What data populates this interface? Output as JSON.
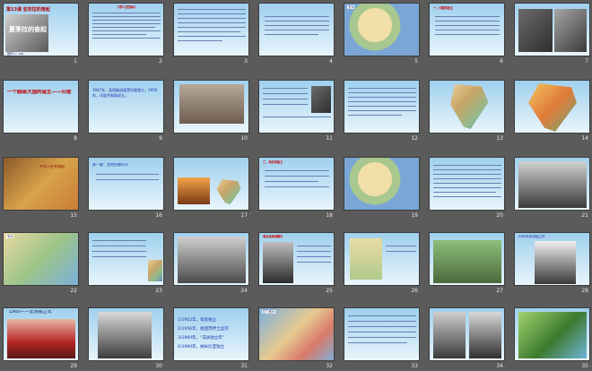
{
  "slides": [
    {
      "n": "1",
      "title": "第13课 亚非拉的奋起",
      "sub": "夏季拉的奋起",
      "author": "制作人：xxx"
    },
    {
      "n": "2",
      "heading": "【学习目标】"
    },
    {
      "n": "3"
    },
    {
      "n": "4"
    },
    {
      "n": "5",
      "label": "亚洲"
    },
    {
      "n": "6",
      "heading": "一、印度的独立"
    },
    {
      "n": "7"
    },
    {
      "n": "8",
      "text": "一个超级大国的诞生——印度"
    },
    {
      "n": "9",
      "text": "1947年，英国被迫接受印度独立。1950年，印度共和国成立。"
    },
    {
      "n": "10"
    },
    {
      "n": "11"
    },
    {
      "n": "12"
    },
    {
      "n": "13"
    },
    {
      "n": "14"
    },
    {
      "n": "15",
      "label": "中华人民共和国"
    },
    {
      "n": "16",
      "text": "第一题：甘地在做什么"
    },
    {
      "n": "17"
    },
    {
      "n": "18",
      "heading": "二、埃及的独立"
    },
    {
      "n": "19"
    },
    {
      "n": "20"
    },
    {
      "n": "21"
    },
    {
      "n": "22",
      "label": "非洲"
    },
    {
      "n": "23"
    },
    {
      "n": "24"
    },
    {
      "n": "25",
      "heading": "埃及总统纳赛尔"
    },
    {
      "n": "26"
    },
    {
      "n": "27"
    },
    {
      "n": "28",
      "heading": "1960年非洲独立年"
    },
    {
      "n": "29",
      "heading": "1960——非洲独立年"
    },
    {
      "n": "30"
    },
    {
      "n": "31",
      "items": [
        "1)1952年，埃及独立",
        "2)1956年，收回苏伊士运河",
        "3)1960年，“非洲独立年”",
        "4)1990年，纳米比亚独立"
      ]
    },
    {
      "n": "32",
      "label": "拉丁美洲"
    },
    {
      "n": "33"
    },
    {
      "n": "34"
    },
    {
      "n": "35"
    }
  ]
}
